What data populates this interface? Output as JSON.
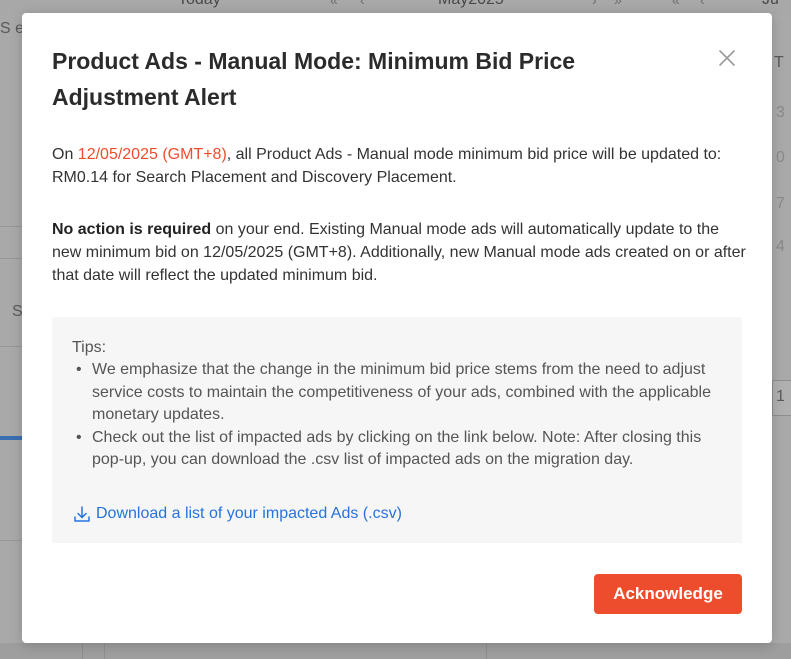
{
  "background": {
    "cal_left_label": "Today",
    "cal_month": "May2025",
    "cal_right_partial": "Ju",
    "left_fragment_1": "S ef",
    "left_fragment_2": "S",
    "right_fragment_1": "T",
    "right_fragment_2": "3",
    "right_fragment_3": "0",
    "right_fragment_4": "7",
    "right_fragment_5": "4",
    "right_fragment_6": "1"
  },
  "modal": {
    "title": "Product Ads - Manual Mode: Minimum Bid Price Adjustment Alert",
    "close_icon": "close-icon",
    "para1": {
      "prefix": "On ",
      "date": "12/05/2025 (GMT+8)",
      "rest": ", all Product Ads - Manual mode minimum bid price will be updated to: RM0.14 for Search Placement and Discovery Placement."
    },
    "para2": {
      "bold": "No action is required",
      "rest": " on your end. Existing Manual mode ads will automatically update to the new minimum bid on 12/05/2025 (GMT+8). Additionally, new Manual mode ads created on or after that date will reflect the updated minimum bid."
    },
    "tips": {
      "title": "Tips:",
      "items": [
        "We emphasize that the change in the minimum bid price stems from the need to adjust service costs to maintain the competitiveness of your ads, combined with the applicable monetary updates.",
        "Check out the list of impacted ads by clicking on the link below. Note: After closing this pop-up, you can download the .csv list of impacted ads on the migration day."
      ],
      "download_link": "Download a list of your impacted Ads (.csv)",
      "download_icon": "download-icon"
    },
    "acknowledge_button": "Acknowledge"
  },
  "colors": {
    "accent": "#ee4d2d",
    "link": "#2673dd",
    "overlay": "#a3a3a3"
  }
}
